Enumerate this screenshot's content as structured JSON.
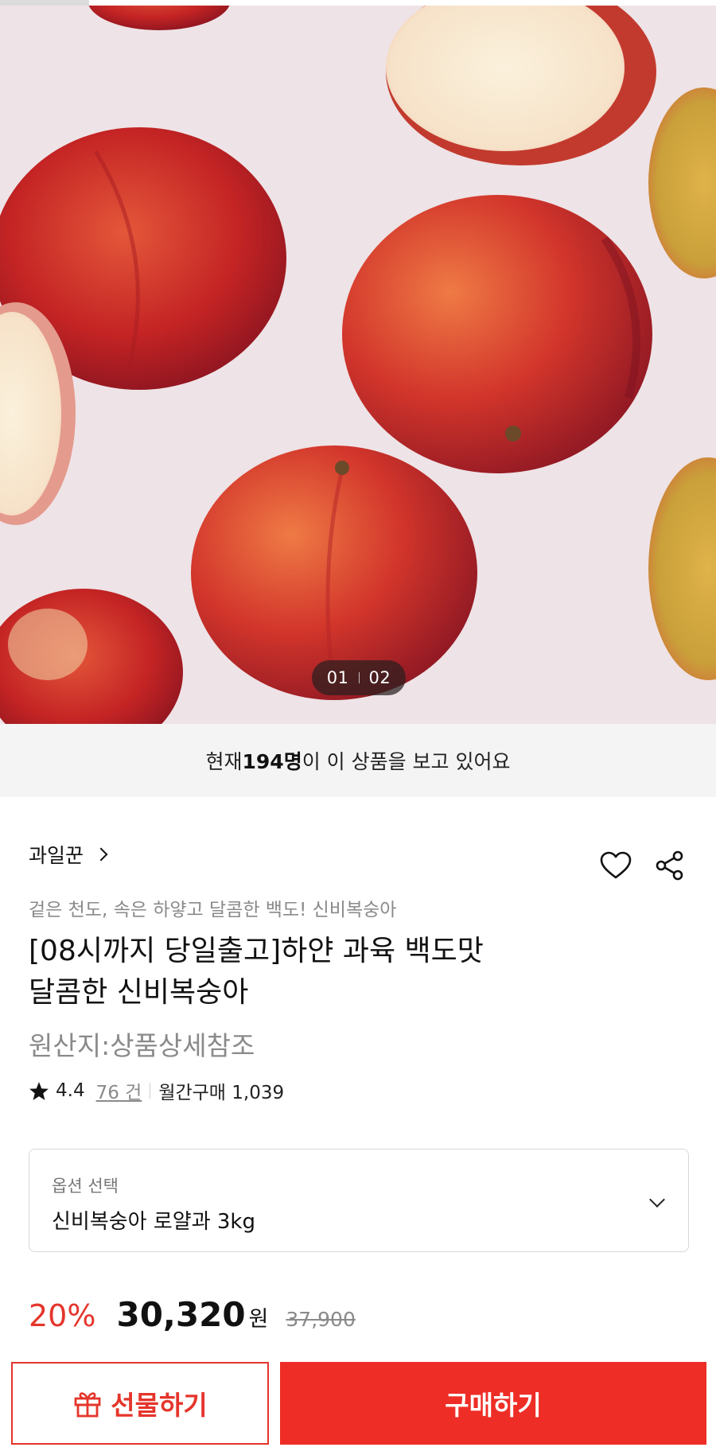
{
  "hero": {
    "pager": {
      "current": "01",
      "total": "02"
    }
  },
  "viewer": {
    "prefix": "현재 ",
    "count": "194명",
    "suffix": "이 이 상품을 보고 있어요"
  },
  "product": {
    "seller": "과일꾼",
    "subtitle": "겉은 천도, 속은 하얗고 달콤한 백도! 신비복숭아",
    "title_line1": "[08시까지 당일출고]하얀 과육 백도맛",
    "title_line2": "달콤한 신비복숭아",
    "origin": "원산지:상품상세참조",
    "rating": {
      "score": "4.4",
      "review_count": "76 건",
      "monthly_purchases": "월간구매 1,039"
    }
  },
  "option": {
    "label": "옵션 선택",
    "selected": "신비복숭아 로얄과 3kg"
  },
  "price": {
    "discount": "20%",
    "amount": "30,320",
    "currency": "원",
    "original": "37,900"
  },
  "buttons": {
    "gift": "선물하기",
    "buy": "구매하기"
  },
  "icons": [
    "heart-icon",
    "share-icon",
    "star-icon",
    "gift-icon",
    "chevron-right-icon",
    "chevron-down-icon"
  ],
  "colors": {
    "accent": "#ee2d26",
    "discount": "#e5352b",
    "muted": "#8a8a8a"
  }
}
